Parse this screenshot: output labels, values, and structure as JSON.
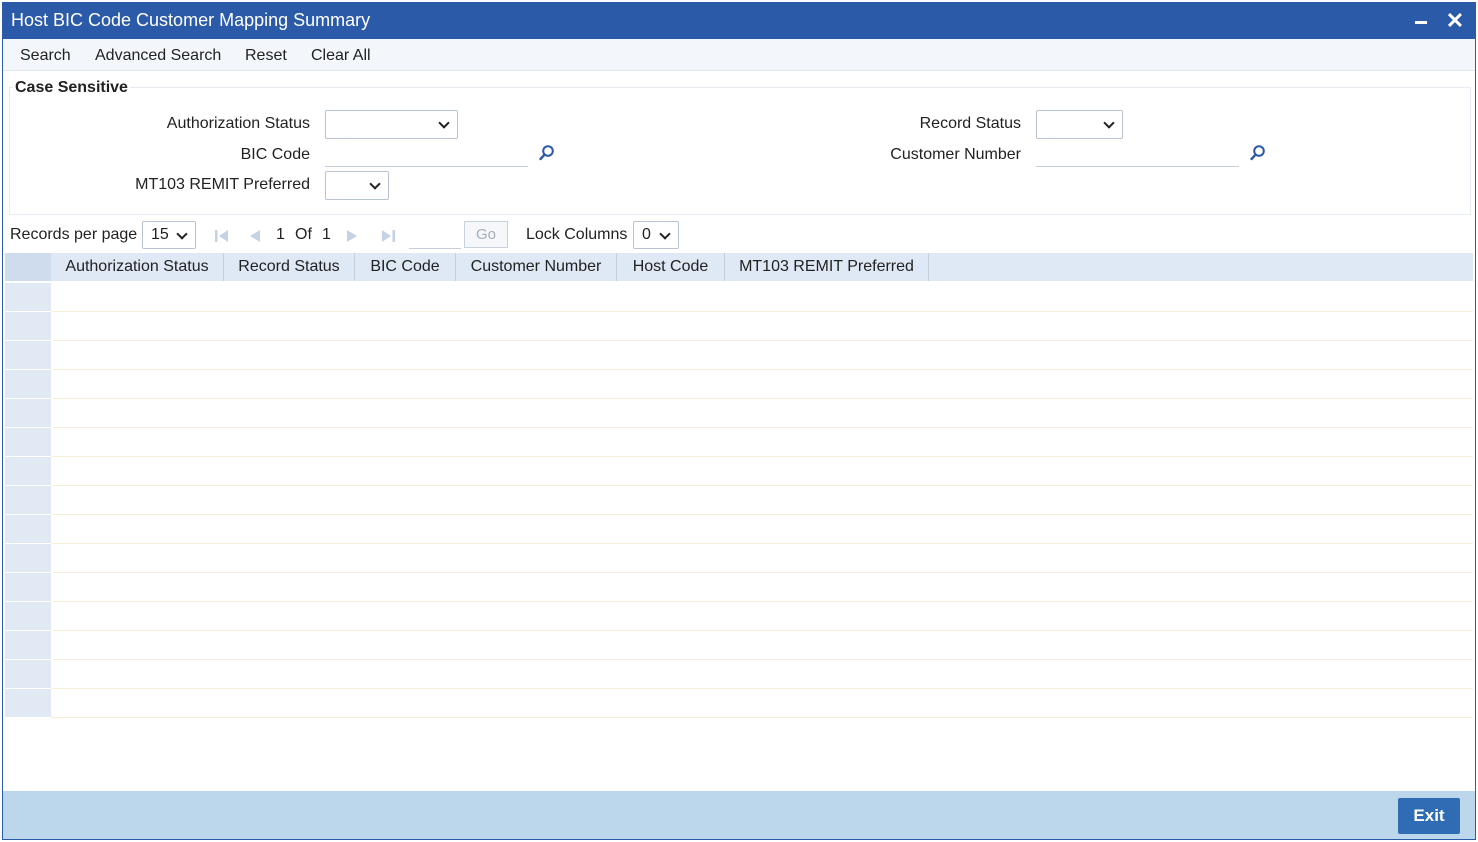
{
  "window": {
    "title": "Host BIC Code Customer Mapping Summary",
    "minimize_icon": "minimize-icon",
    "close_icon": "close-icon",
    "close_glyph": "✕"
  },
  "menu": {
    "search": "Search",
    "advanced_search": "Advanced Search",
    "reset": "Reset",
    "clear_all": "Clear All"
  },
  "criteria": {
    "legend": "Case Sensitive",
    "authorization_status": {
      "label": "Authorization Status",
      "value": ""
    },
    "record_status": {
      "label": "Record Status",
      "value": ""
    },
    "bic_code": {
      "label": "BIC Code",
      "value": "",
      "lookup_icon": "search-icon"
    },
    "customer_number": {
      "label": "Customer Number",
      "value": "",
      "lookup_icon": "search-icon"
    },
    "mt103_remit_preferred": {
      "label": "MT103 REMIT Preferred",
      "value": ""
    }
  },
  "pager": {
    "records_per_page_label": "Records per page",
    "records_per_page": "15",
    "current_page": "1",
    "of_label": "Of",
    "total_pages": "1",
    "go_label": "Go",
    "lock_columns_label": "Lock Columns",
    "lock_columns": "0"
  },
  "grid": {
    "columns": [
      "Authorization Status",
      "Record Status",
      "BIC Code",
      "Customer Number",
      "Host Code",
      "MT103 REMIT Preferred"
    ],
    "visible_empty_rows": 15
  },
  "footer": {
    "exit": "Exit"
  },
  "colors": {
    "title_bar": "#2b5aa8",
    "grid_header": "#dfe8f5",
    "footer": "#bcd6ec",
    "exit_button": "#2f6cb3"
  }
}
